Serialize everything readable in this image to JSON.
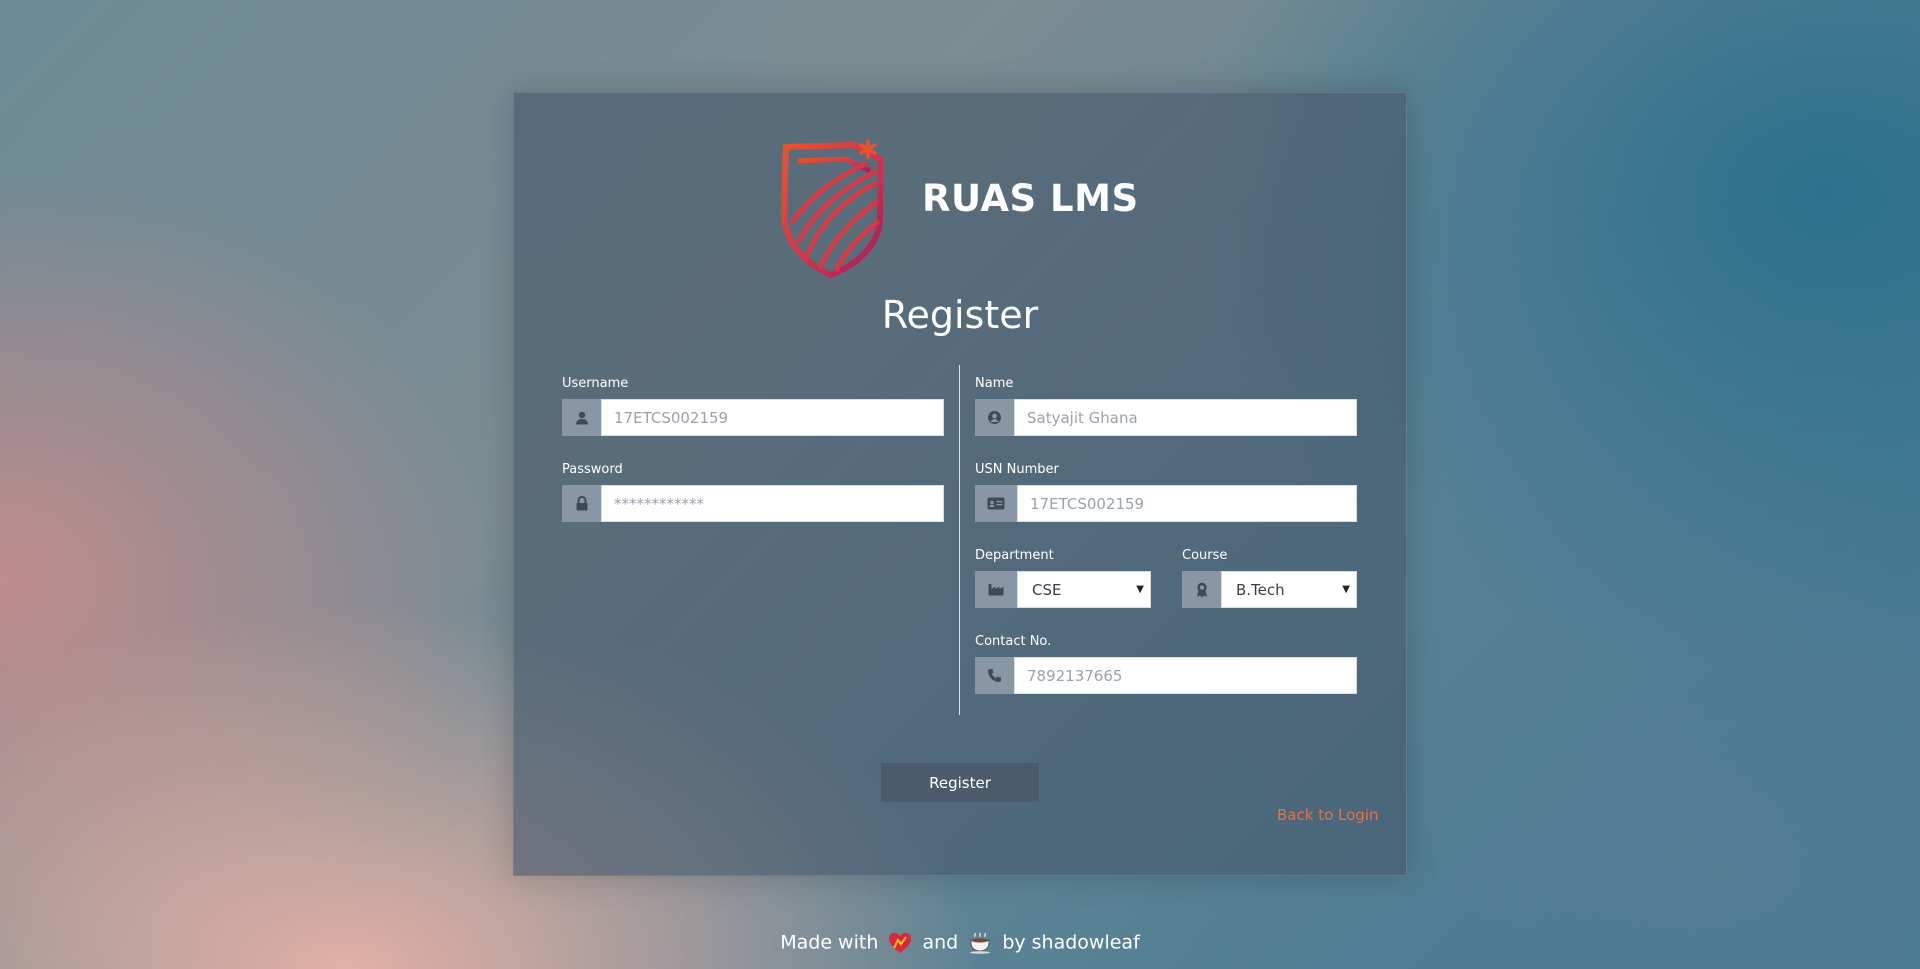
{
  "brand": {
    "name": "RUAS LMS",
    "logo_icon": "ruas-shield-logo"
  },
  "page": {
    "title": "Register"
  },
  "form": {
    "username": {
      "label": "Username",
      "placeholder": "17ETCS002159",
      "icon": "user-icon"
    },
    "password": {
      "label": "Password",
      "placeholder": "************",
      "icon": "lock-icon"
    },
    "name": {
      "label": "Name",
      "placeholder": "Satyajit Ghana",
      "icon": "user-circle-icon"
    },
    "usn": {
      "label": "USN Number",
      "placeholder": "17ETCS002159",
      "icon": "id-card-icon"
    },
    "department": {
      "label": "Department",
      "value": "CSE",
      "icon": "industry-icon"
    },
    "course": {
      "label": "Course",
      "value": "B.Tech",
      "icon": "award-icon"
    },
    "contact": {
      "label": "Contact No.",
      "placeholder": "7892137665",
      "icon": "phone-icon"
    }
  },
  "actions": {
    "register_label": "Register",
    "back_label": "Back to Login"
  },
  "footer": {
    "part1": "Made with",
    "part2": "and",
    "part3": "by shadowleaf",
    "heart_icon": "heart-icon",
    "coffee_icon": "coffee-icon"
  },
  "colors": {
    "accent": "#e8733f",
    "button": "#4b5b6b",
    "addon": "#8996a6"
  }
}
